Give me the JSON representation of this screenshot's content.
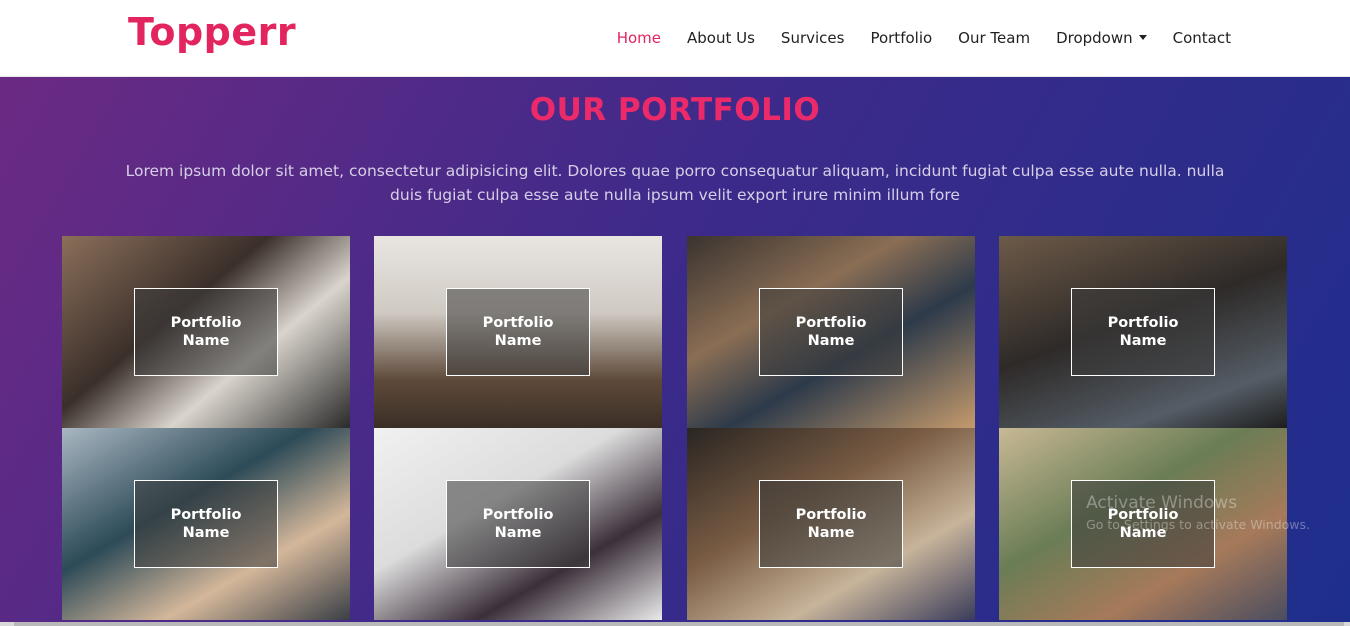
{
  "brand": {
    "name": "Topperr",
    "color": "#e2245f"
  },
  "nav": {
    "items": [
      {
        "label": "Home",
        "active": true
      },
      {
        "label": "About Us",
        "active": false
      },
      {
        "label": "Survices",
        "active": false
      },
      {
        "label": "Portfolio",
        "active": false
      },
      {
        "label": "Our Team",
        "active": false
      },
      {
        "label": "Dropdown",
        "active": false,
        "has_caret": true
      },
      {
        "label": "Contact",
        "active": false
      }
    ]
  },
  "portfolio": {
    "title": "OUR PORTFOLIO",
    "description": "Lorem ipsum dolor sit amet, consectetur adipisicing elit. Dolores quae porro consequatur aliquam, incidunt fugiat culpa esse aute nulla. nulla duis fugiat culpa esse aute nulla ipsum velit export irure minim illum fore",
    "items": [
      {
        "label": "Portfolio Name",
        "image": "meeting-desk-photo"
      },
      {
        "label": "Portfolio Name",
        "image": "conference-room-photo"
      },
      {
        "label": "Portfolio Name",
        "image": "laptop-chart-photo"
      },
      {
        "label": "Portfolio Name",
        "image": "man-laptop-photo"
      },
      {
        "label": "Portfolio Name",
        "image": "woman-imac-photo"
      },
      {
        "label": "Portfolio Name",
        "image": "laptop-notebook-photo"
      },
      {
        "label": "Portfolio Name",
        "image": "coffee-laptop-photo"
      },
      {
        "label": "Portfolio Name",
        "image": "man-office-photo"
      }
    ]
  },
  "watermark": {
    "title": "Activate Windows",
    "subtitle": "Go to Settings to activate Windows."
  },
  "colors": {
    "accent": "#e2245f",
    "section_gradient_start": "#6b2a83",
    "section_gradient_end": "#1e2e8c",
    "nav_text": "#222222"
  }
}
